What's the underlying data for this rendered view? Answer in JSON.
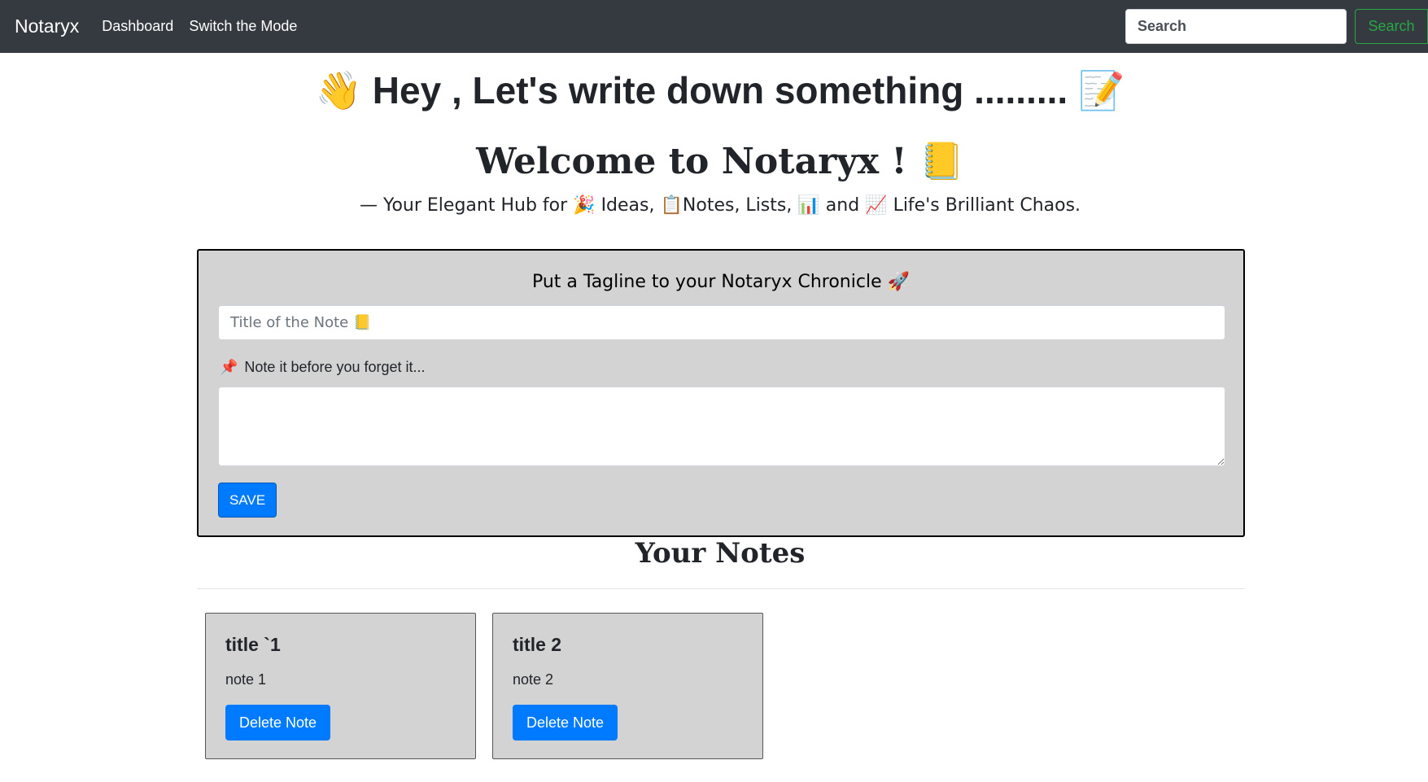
{
  "navbar": {
    "brand": "Notaryx",
    "links": [
      "Dashboard",
      "Switch the Mode"
    ],
    "search_placeholder": "Search",
    "search_button": "Search"
  },
  "hero": {
    "wave": "👋",
    "text": "Hey , Let's write down something .........",
    "memo": "📝"
  },
  "welcome": {
    "text": "Welcome to Notaryx !",
    "notebook": "📒"
  },
  "subtitle": {
    "dash": "— Your Elegant Hub for",
    "e1": "🎉",
    "ideas": "Ideas,",
    "e2": "📋",
    "notes": "Notes, Lists,",
    "e3": "📊",
    "and": "and",
    "e4": "📈",
    "chaos": "Life's Brilliant Chaos."
  },
  "form": {
    "tagline": "Put a Tagline to your Notaryx Chronicle",
    "tagline_emoji": "🚀",
    "title_placeholder": "Title of the Note 📒",
    "note_label_emoji": "📌",
    "note_label": "Note it before you forget it...",
    "note_value": "",
    "save_label": "SAVE"
  },
  "notes_section": {
    "heading": "Your Notes",
    "notes": [
      {
        "title": "title `1",
        "text": "note 1",
        "delete_label": "Delete Note"
      },
      {
        "title": "title 2",
        "text": "note 2",
        "delete_label": "Delete Note"
      }
    ]
  },
  "colors": {
    "navbar": "#343a40",
    "primary": "#007bff",
    "success": "#28a745",
    "panel": "#d3d3d3"
  }
}
